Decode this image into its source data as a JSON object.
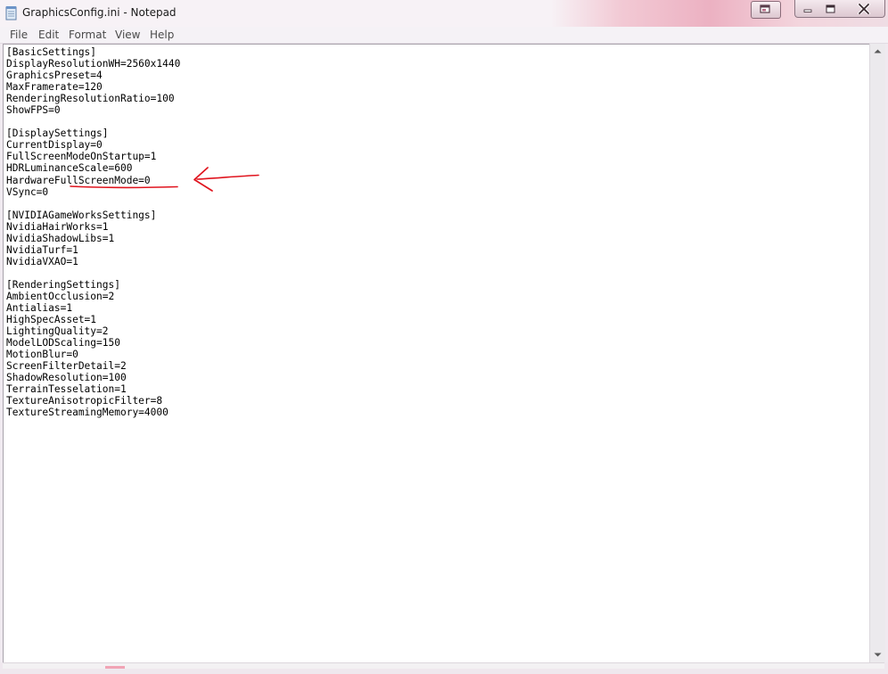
{
  "window": {
    "title": "GraphicsConfig.ini - Notepad"
  },
  "menu": [
    "File",
    "Edit",
    "Format",
    "View",
    "Help"
  ],
  "editor": {
    "lines": [
      "[BasicSettings]",
      "DisplayResolutionWH=2560x1440",
      "GraphicsPreset=4",
      "MaxFramerate=120",
      "RenderingResolutionRatio=100",
      "ShowFPS=0",
      "",
      "[DisplaySettings]",
      "CurrentDisplay=0",
      "FullScreenModeOnStartup=1",
      "HDRLuminanceScale=600",
      "HardwareFullScreenMode=0",
      "VSync=0",
      "",
      "[NVIDIAGameWorksSettings]",
      "NvidiaHairWorks=1",
      "NvidiaShadowLibs=1",
      "NvidiaTurf=1",
      "NvidiaVXAO=1",
      "",
      "[RenderingSettings]",
      "AmbientOcclusion=2",
      "Antialias=1",
      "HighSpecAsset=1",
      "LightingQuality=2",
      "ModelLODScaling=150",
      "MotionBlur=0",
      "ScreenFilterDetail=2",
      "ShadowResolution=100",
      "TerrainTesselation=1",
      "TextureAnisotropicFilter=8",
      "TextureStreamingMemory=4000"
    ]
  },
  "icons": {
    "app": "notepad-icon",
    "restore": "restore-window-icon",
    "minimize": "minimize-icon",
    "maximize": "maximize-icon",
    "close": "close-icon",
    "annotation": "red-arrow-annotation"
  },
  "colors": {
    "annotation": "#e0141e",
    "close_button": "#dcc7d0",
    "editor_background": "#ffffff"
  }
}
